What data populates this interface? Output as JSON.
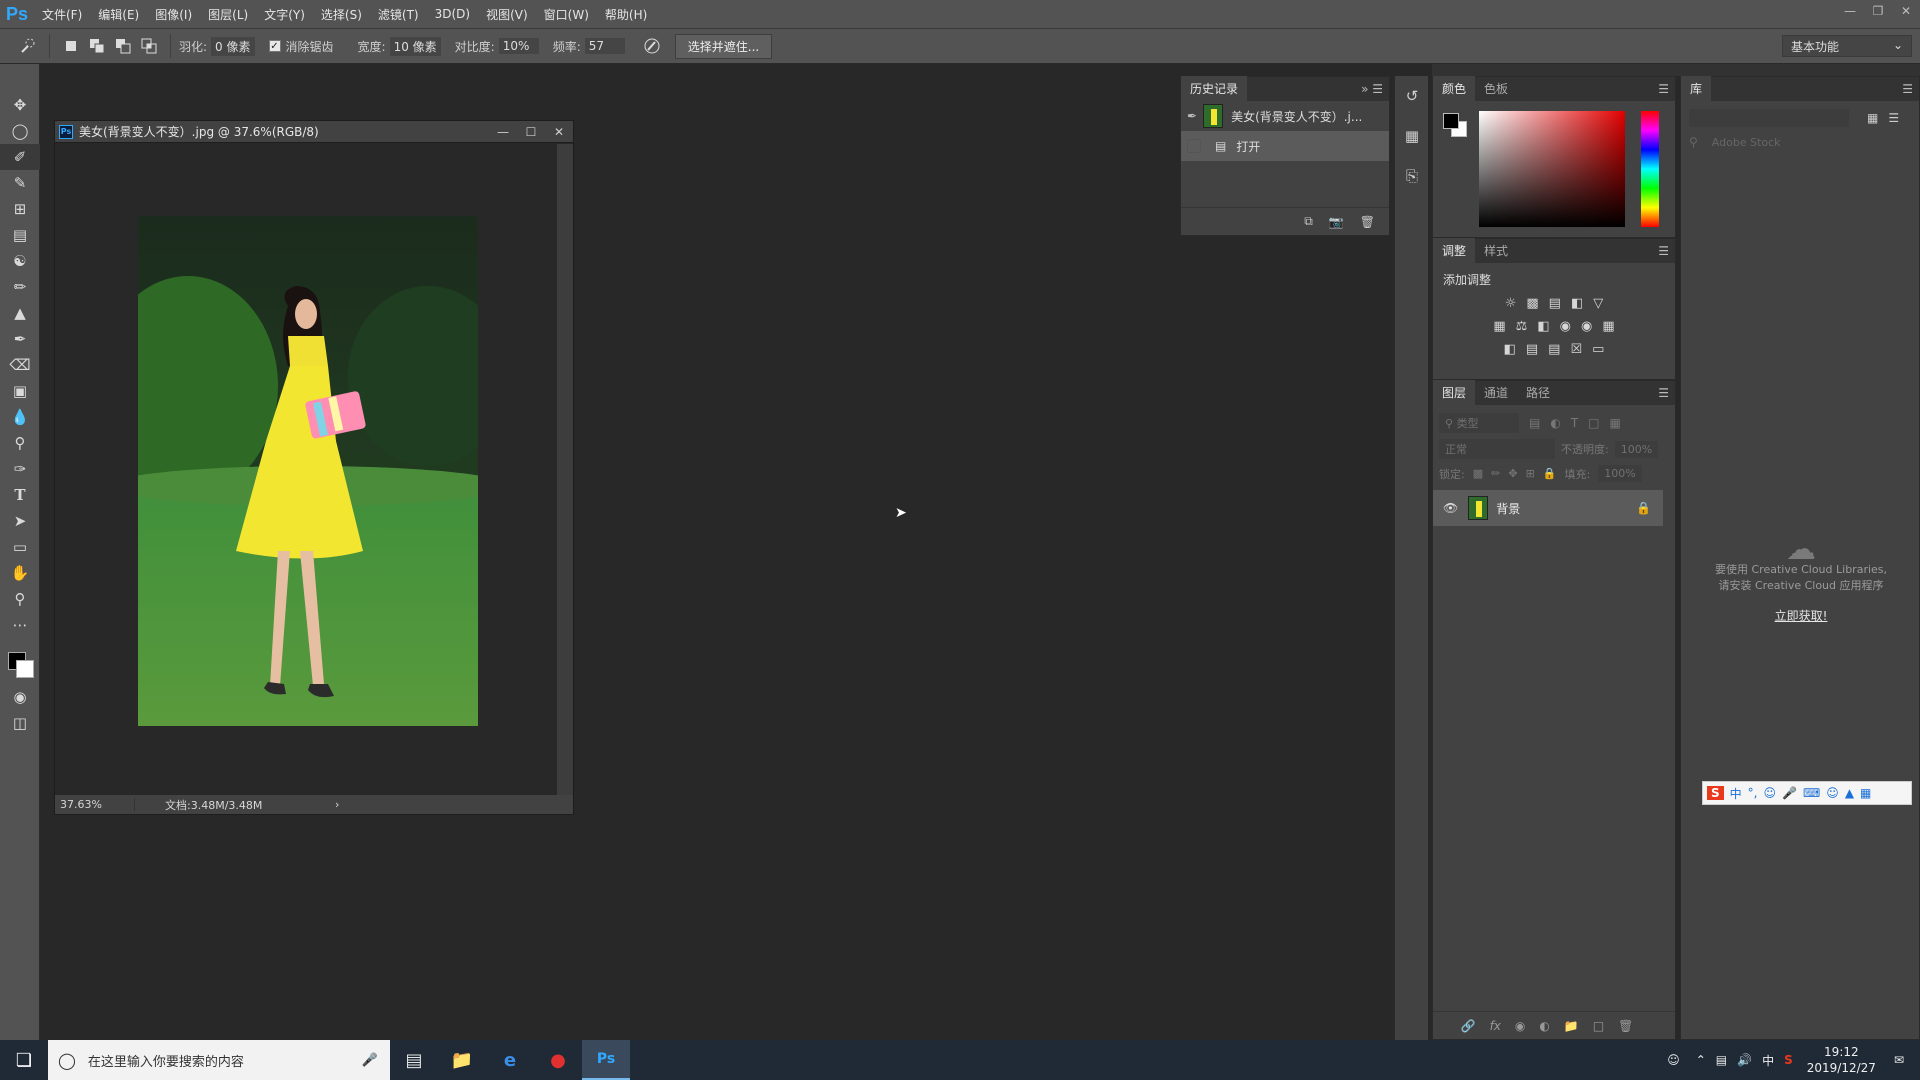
{
  "app": {
    "logo": "Ps"
  },
  "menu": [
    "文件(F)",
    "编辑(E)",
    "图像(I)",
    "图层(L)",
    "文字(Y)",
    "选择(S)",
    "滤镜(T)",
    "3D(D)",
    "视图(V)",
    "窗口(W)",
    "帮助(H)"
  ],
  "options": {
    "feather_label": "羽化:",
    "feather_value": "0 像素",
    "antialias_label": "消除锯齿",
    "antialias_checked": true,
    "width_label": "宽度:",
    "width_value": "10 像素",
    "contrast_label": "对比度:",
    "contrast_value": "10%",
    "frequency_label": "频率:",
    "frequency_value": "57",
    "select_mask_label": "选择并遮住...",
    "workspace": "基本功能"
  },
  "document": {
    "title": "美女(背景变人不变）.jpg @ 37.6%(RGB/8)",
    "zoom": "37.63%",
    "doc_info": "文档:3.48M/3.48M"
  },
  "history": {
    "tab_label": "历史记录",
    "snapshot_label": "美女(背景变人不变）.j...",
    "steps": [
      "打开"
    ]
  },
  "color_panel": {
    "tabs": [
      "颜色",
      "色板"
    ],
    "foreground": "#000000",
    "background": "#ffffff"
  },
  "adjust_panel": {
    "tabs": [
      "调整",
      "样式"
    ],
    "add_label": "添加调整"
  },
  "layers_panel": {
    "tabs": [
      "图层",
      "通道",
      "路径"
    ],
    "filter_placeholder": "类型",
    "blend_mode": "正常",
    "opacity_label": "不透明度:",
    "opacity_value": "100%",
    "lock_label": "锁定:",
    "fill_label": "填充:",
    "fill_value": "100%",
    "layers": [
      {
        "name": "背景",
        "visible": true,
        "locked": true
      }
    ]
  },
  "library_panel": {
    "tab_label": "库",
    "search_placeholder": "Adobe Stock",
    "message_line1": "要使用 Creative Cloud Libraries,",
    "message_line2": "请安装 Creative Cloud 应用程序",
    "link_label": "立即获取!"
  },
  "taskbar": {
    "search_placeholder": "在这里输入你要搜索的内容",
    "ime_lang": "中",
    "time": "19:12",
    "date": "2019/12/27"
  },
  "ime_bar": {
    "lang": "中"
  }
}
